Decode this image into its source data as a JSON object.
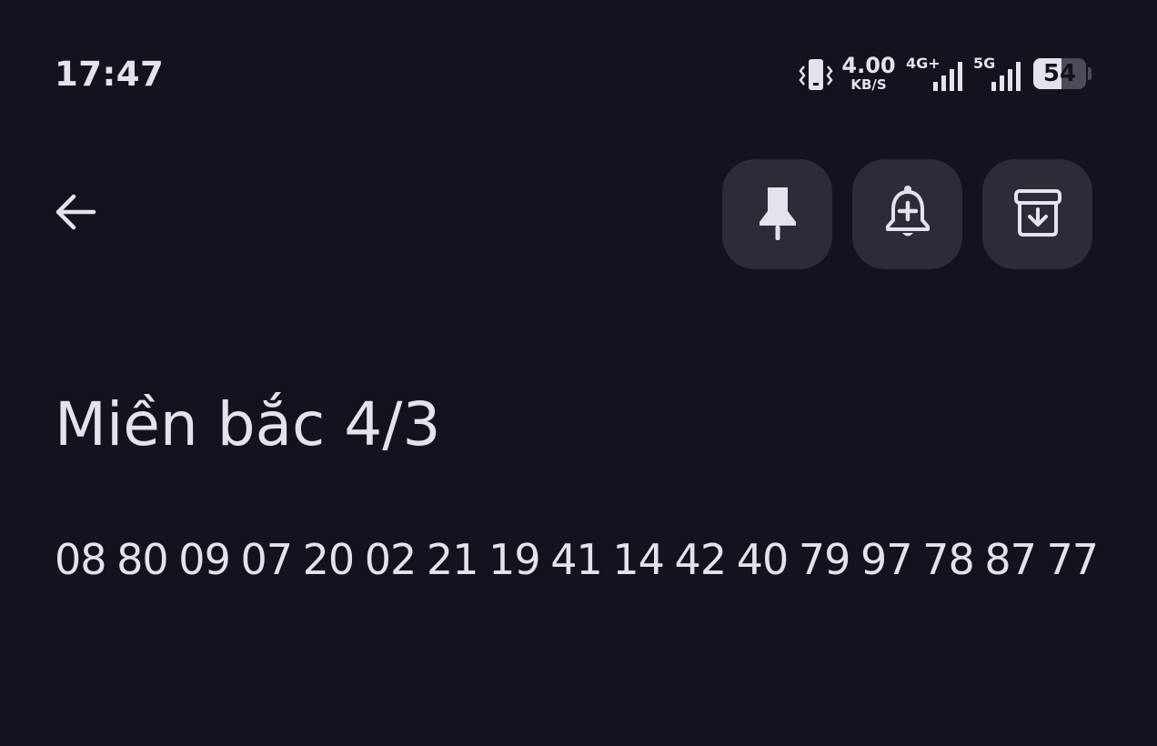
{
  "status_bar": {
    "time": "17:47",
    "network_speed_value": "4.00",
    "network_speed_unit": "KB/S",
    "signal_1_label": "4G+",
    "signal_2_label": "5G",
    "battery_level": "54",
    "battery_fraction": 0.54,
    "icons": [
      "vibrate-icon",
      "signal-4g-icon",
      "signal-5g-icon",
      "battery-icon"
    ]
  },
  "toolbar": {
    "back_icon": "arrow-back-icon",
    "actions": [
      {
        "name": "pin",
        "icon": "pin-icon"
      },
      {
        "name": "reminder",
        "icon": "bell-plus-icon"
      },
      {
        "name": "archive",
        "icon": "archive-icon"
      }
    ]
  },
  "note": {
    "title": "Miền bắc 4/3",
    "body": "08 80 09 07 20 02 21 19 41 14 42 40 79 97 78 87 77"
  },
  "colors": {
    "background": "#12141d",
    "button_background": "#2a2c37",
    "foreground": "#e3e3ec"
  }
}
